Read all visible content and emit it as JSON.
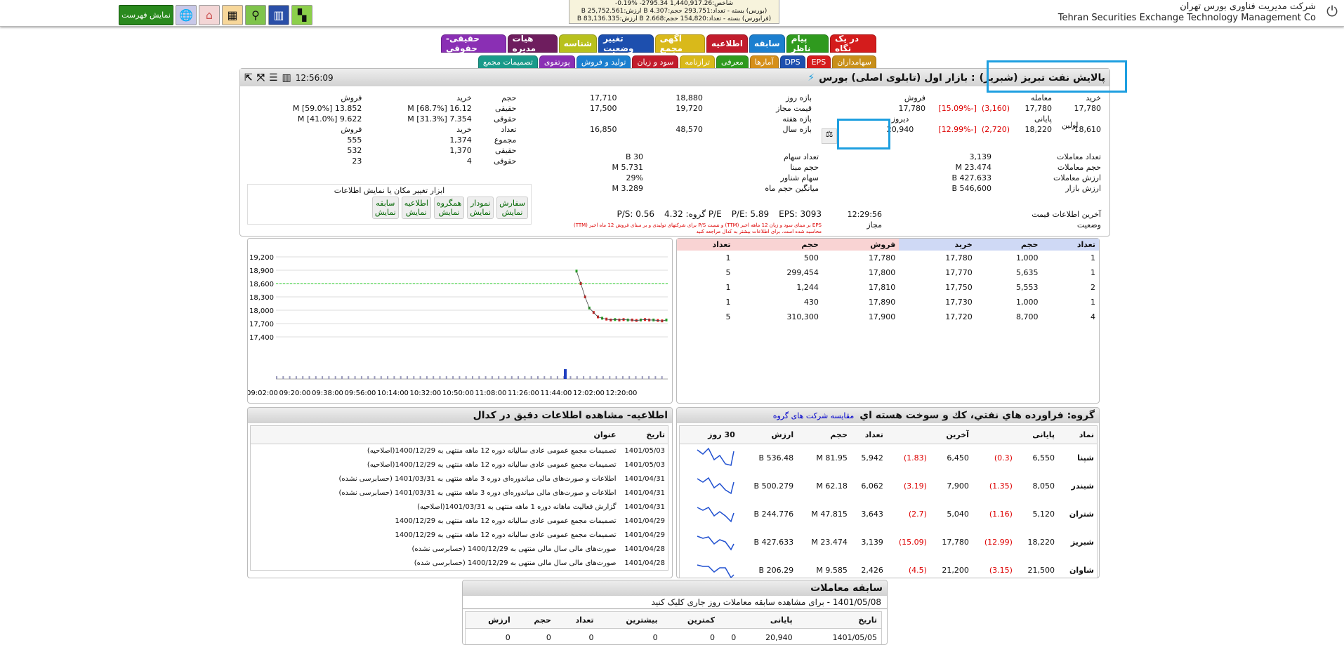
{
  "header": {
    "company_fa": "شرکت مدیریت فناوری بورس تهران",
    "company_en": "Tehran Securities Exchange Technology Management Co",
    "index_line1": "شاخص:1,440,917.26 2795.34- %0.19-",
    "index_line2": "(بورس) بسته - تعداد:293,751 حجم:4.307 B ارزش:25,752.561 B",
    "index_line3": "(فرابورس) بسته - تعداد:154,820 حجم:2.668 B ارزش:83,136.335 B",
    "show_menu": "نمایش فهرست"
  },
  "tabs_row1": [
    {
      "label": "در یک نگاه",
      "color": "#d41c1c"
    },
    {
      "label": "پیام ناظر",
      "color": "#2f9a1e"
    },
    {
      "label": "سابقه",
      "color": "#1c7fcf"
    },
    {
      "label": "اطلاعیه",
      "color": "#c21c2c"
    },
    {
      "label": "آگهی مجمع",
      "color": "#d9b91a"
    },
    {
      "label": "تغییر وضعیت",
      "color": "#1d4fae"
    },
    {
      "label": "شناسه",
      "color": "#b8c11d"
    },
    {
      "label": "هیات مدیره",
      "color": "#6e1d5e"
    },
    {
      "label": "حقیقی-حقوقی",
      "color": "#8a2fb4"
    }
  ],
  "tabs_row2": [
    {
      "label": "سهامداران",
      "color": "#c88f1a"
    },
    {
      "label": "EPS",
      "color": "#d41c1c"
    },
    {
      "label": "DPS",
      "color": "#1d4fae"
    },
    {
      "label": "آمارها",
      "color": "#d58f1a"
    },
    {
      "label": "معرفی",
      "color": "#2f9a1e"
    },
    {
      "label": "ترازنامه",
      "color": "#d9b91a"
    },
    {
      "label": "سود و زیان",
      "color": "#c21c2c"
    },
    {
      "label": "تولید و فروش",
      "color": "#1c7fcf"
    },
    {
      "label": "پورتفوی",
      "color": "#8a2fb4"
    },
    {
      "label": "تصمیمات مجمع",
      "color": "#1a9a8a"
    }
  ],
  "title": {
    "name": "پالایش نفت تبریز (شبریز)",
    "market": ": بازار اول (تابلوی اصلی) بورس",
    "time": "12:56:09"
  },
  "price": {
    "h_buy": "خرید",
    "h_trade": "معامله",
    "h_sell": "فروش",
    "buy1": "17,780",
    "trade": "17,780",
    "trade_chg": "(3,160)",
    "trade_pct": "[-15.09%]",
    "sell_label": "فروش",
    "sell_val": "17,780",
    "first_l": "اولین",
    "first": "18,610",
    "final_l": "پایانی",
    "final": "18,220",
    "final_chg": "(2,720)",
    "final_pct": "[-12.99%]",
    "yesterday_l": "دیروز",
    "yesterday": "20,940",
    "dayrange_l": "بازه روز",
    "dayrange_hi": "18,880",
    "dayrange_lo": "17,710",
    "allowed_l": "قیمت مجاز",
    "allowed_hi": "19,720",
    "allowed_lo": "17,500",
    "week_l": "بازه هفته",
    "year_l": "بازه سال",
    "year_hi": "48,570",
    "year_lo": "16,850"
  },
  "stats": [
    {
      "l": "تعداد معاملات",
      "v": "3,139"
    },
    {
      "l": "حجم معاملات",
      "v": "23.474 M"
    },
    {
      "l": "ارزش معاملات",
      "v": "427.633 B"
    },
    {
      "l": "ارزش بازار",
      "v": "546,600 B"
    }
  ],
  "stats2": [
    {
      "l": "تعداد سهام",
      "v": "30 B"
    },
    {
      "l": "حجم مبنا",
      "v": "5.731 M"
    },
    {
      "l": "سهام شناور",
      "v": "29%"
    },
    {
      "l": "میانگین حجم ماه",
      "v": "3.289 M"
    }
  ],
  "last_info": {
    "l": "آخرین اطلاعات قیمت",
    "v": "12:29:56",
    "status_l": "وضعیت",
    "status": "مجاز"
  },
  "ratios": {
    "eps_l": "EPS:",
    "eps": "3093",
    "pe_l": "P/E:",
    "pe": "5.89",
    "gpe_l": "P/E گروه:",
    "gpe": "4.32",
    "ps_l": "P/S:",
    "ps": "0.56",
    "note1": "EPS بر مبنای سود و زیان 12 ماهه اخیر (TTM) و نسبت P/S برای شرکتهای تولیدی و بر مبنای فروش 12 ماه اخیر (TTM)",
    "note2": "محاسبه شده است. برای اطلاعات بیشتر به کدال مراجعه کنید"
  },
  "legal": {
    "h_vol": "حجم",
    "h_buy": "خرید",
    "h_sell": "فروش",
    "real_l": "حقیقی",
    "real_buy": "16.12 M [68.7%]",
    "real_sell": "13.852 M [59.0%]",
    "legal_l": "حقوقی",
    "legal_buy": "7.354 M [31.3%]",
    "legal_sell": "9.622 M [41.0%]",
    "h_cnt": "تعداد",
    "total_l": "مجموع",
    "total_buy": "1,374",
    "total_sell": "555",
    "rcnt_buy": "1,370",
    "rcnt_sell": "532",
    "lcnt_buy": "4",
    "lcnt_sell": "23"
  },
  "tools": {
    "title": "ابزار تغییر مکان یا نمایش اطلاعات",
    "buttons": [
      {
        "a": "سفارش",
        "b": "نمایش"
      },
      {
        "a": "نمودار",
        "b": "نمایش"
      },
      {
        "a": "همگروه",
        "b": "نمایش"
      },
      {
        "a": "اطلاعیه",
        "b": "نمایش"
      },
      {
        "a": "سابقه",
        "b": "نمایش"
      }
    ]
  },
  "orderbook": {
    "headers": [
      "تعداد",
      "حجم",
      "خرید",
      "فروش",
      "حجم",
      "تعداد"
    ],
    "rows": [
      [
        "1",
        "1,000",
        "17,780",
        "17,780",
        "500",
        "1"
      ],
      [
        "1",
        "5,635",
        "17,770",
        "17,800",
        "299,454",
        "5"
      ],
      [
        "2",
        "5,553",
        "17,750",
        "17,810",
        "1,244",
        "1"
      ],
      [
        "1",
        "1,000",
        "17,730",
        "17,890",
        "430",
        "1"
      ],
      [
        "4",
        "8,700",
        "17,720",
        "17,900",
        "310,300",
        "5"
      ]
    ]
  },
  "chart_data": {
    "type": "line",
    "title": "",
    "yticks": [
      "19,200",
      "18,900",
      "18,600",
      "18,300",
      "18,000",
      "17,700",
      "17,400"
    ],
    "ylim": [
      17400,
      19200
    ],
    "xticks": [
      "09:02:00",
      "09:20:00",
      "09:38:00",
      "09:56:00",
      "10:14:00",
      "10:32:00",
      "10:50:00",
      "11:08:00",
      "11:26:00",
      "11:44:00",
      "12:02:00",
      "12:20:00"
    ],
    "ref_line": 18600,
    "series": [
      {
        "values": [
          18880,
          18600,
          18300,
          18050,
          17950,
          17850,
          17820,
          17800,
          17780,
          17790,
          17780,
          17790,
          17780,
          17780,
          17770,
          17780,
          17790,
          17780,
          17780,
          17770,
          17760,
          17780
        ]
      }
    ]
  },
  "group": {
    "title": "گروه: فراورده هاي نفتي، كك و سوخت هسته اي",
    "compare": "مقایسه شرکت های گروه",
    "headers": [
      "نماد",
      "پایانی",
      "",
      "آخرین",
      "",
      "تعداد",
      "حجم",
      "ارزش",
      "30 روز"
    ],
    "rows": [
      [
        "شپنا",
        "6,550",
        "(0.3)",
        "6,450",
        "(1.83)",
        "5,942",
        "81.95 M",
        "536.48 B"
      ],
      [
        "شبندر",
        "8,050",
        "(1.35)",
        "7,900",
        "(3.19)",
        "6,062",
        "62.18 M",
        "500.279 B"
      ],
      [
        "شتران",
        "5,120",
        "(1.16)",
        "5,040",
        "(2.7)",
        "3,643",
        "47.815 M",
        "244.776 B"
      ],
      [
        "شبریز",
        "18,220",
        "(12.99)",
        "17,780",
        "(15.09)",
        "3,139",
        "23.474 M",
        "427.633 B"
      ],
      [
        "شاوان",
        "21,500",
        "(3.15)",
        "21,200",
        "(4.5)",
        "2,426",
        "9.585 M",
        "206.29 B"
      ]
    ]
  },
  "news": {
    "title": "اطلاعیه- مشاهده اطلاعات دقیق در کدال",
    "h_date": "تاریخ",
    "h_title": "عنوان",
    "rows": [
      [
        "1401/05/03",
        "تصمیمات مجمع عمومی عادی سالیانه دوره 12 ماهه منتهی به 1400/12/29(اصلاحیه)"
      ],
      [
        "1401/05/03",
        "تصمیمات مجمع عمومی عادی سالیانه دوره 12 ماهه منتهی به 1400/12/29(اصلاحیه)"
      ],
      [
        "1401/04/31",
        "اطلاعات و صورت‌های مالی میاندوره‌ای دوره 3 ماهه منتهی به 1401/03/31 (حسابرسی نشده)"
      ],
      [
        "1401/04/31",
        "اطلاعات و صورت‌های مالی میاندوره‌ای دوره 3 ماهه منتهی به 1401/03/31 (حسابرسی نشده)"
      ],
      [
        "1401/04/31",
        "گزارش فعالیت ماهانه دوره 1 ماهه منتهی به 1401/03/31(اصلاحیه)"
      ],
      [
        "1401/04/29",
        "تصمیمات مجمع عمومی عادی سالیانه دوره 12 ماهه منتهی به 1400/12/29"
      ],
      [
        "1401/04/29",
        "تصمیمات مجمع عمومی عادی سالیانه دوره 12 ماهه منتهی به 1400/12/29"
      ],
      [
        "1401/04/28",
        "صورت‌های مالی سال مالی منتهی به 1400/12/29 (حسابرسی نشده)"
      ],
      [
        "1401/04/28",
        "صورت‌های مالی سال مالی منتهی به 1400/12/29 (حسابرسی شده)"
      ]
    ]
  },
  "history": {
    "title": "سابقه معاملات",
    "subtitle": "1401/05/08 - برای مشاهده سابقه معاملات روز جاری کلیک کنید",
    "headers": [
      "تاریخ",
      "پایانی",
      "",
      "کمترین",
      "بیشترین",
      "تعداد",
      "حجم",
      "ارزش"
    ],
    "row": [
      "1401/05/05",
      "20,940",
      "0",
      "0",
      "0",
      "0",
      "0",
      "0"
    ]
  }
}
